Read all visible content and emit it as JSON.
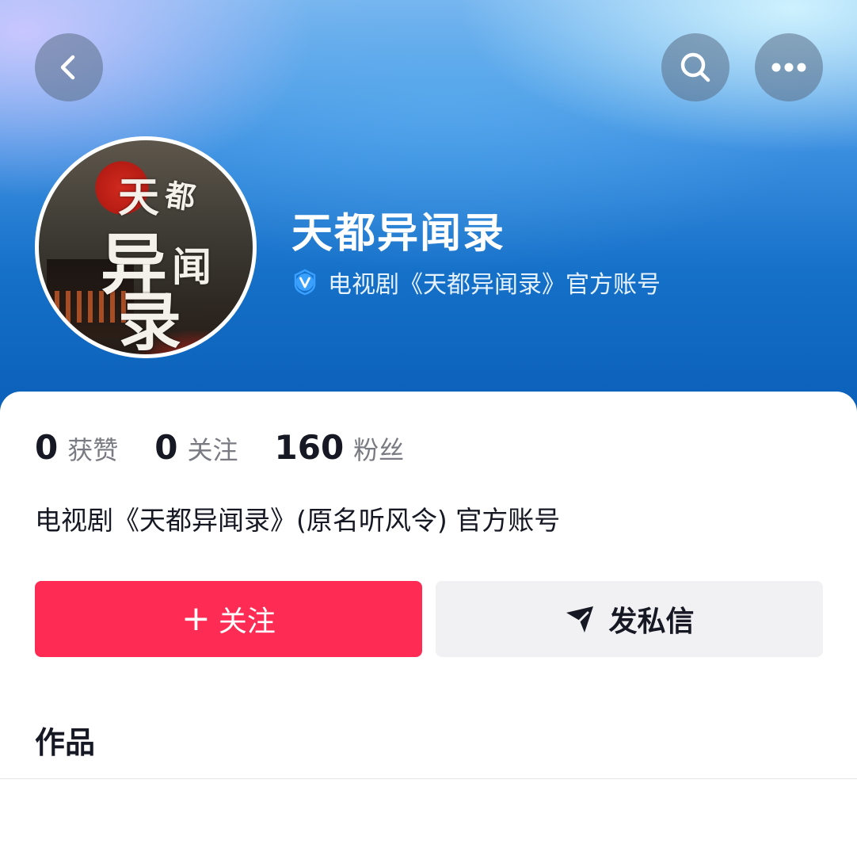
{
  "header": {
    "back_icon": "chevron-left-icon",
    "search_icon": "search-icon",
    "more_icon": "more-dots-icon"
  },
  "avatar": {
    "calligraphy": [
      "天",
      "都",
      "异",
      "闻",
      "录"
    ]
  },
  "profile": {
    "name": "天都异闻录",
    "verified_icon": "verified-v-icon",
    "verified_text": "电视剧《天都异闻录》官方账号",
    "bio": "电视剧《天都异闻录》(原名听风令) 官方账号"
  },
  "stats": [
    {
      "value": "0",
      "label": "获赞"
    },
    {
      "value": "0",
      "label": "关注"
    },
    {
      "value": "160",
      "label": "粉丝"
    }
  ],
  "actions": {
    "follow_label": "关注",
    "follow_prefix": "+",
    "message_label": "发私信",
    "message_icon": "send-icon"
  },
  "tabs": {
    "works_label": "作品"
  },
  "colors": {
    "follow_button": "#fe2c55",
    "message_button": "#f1f1f3",
    "primary_text": "#161823",
    "secondary_text": "#7a7b82",
    "verified_badge": "#3aa0ff"
  }
}
